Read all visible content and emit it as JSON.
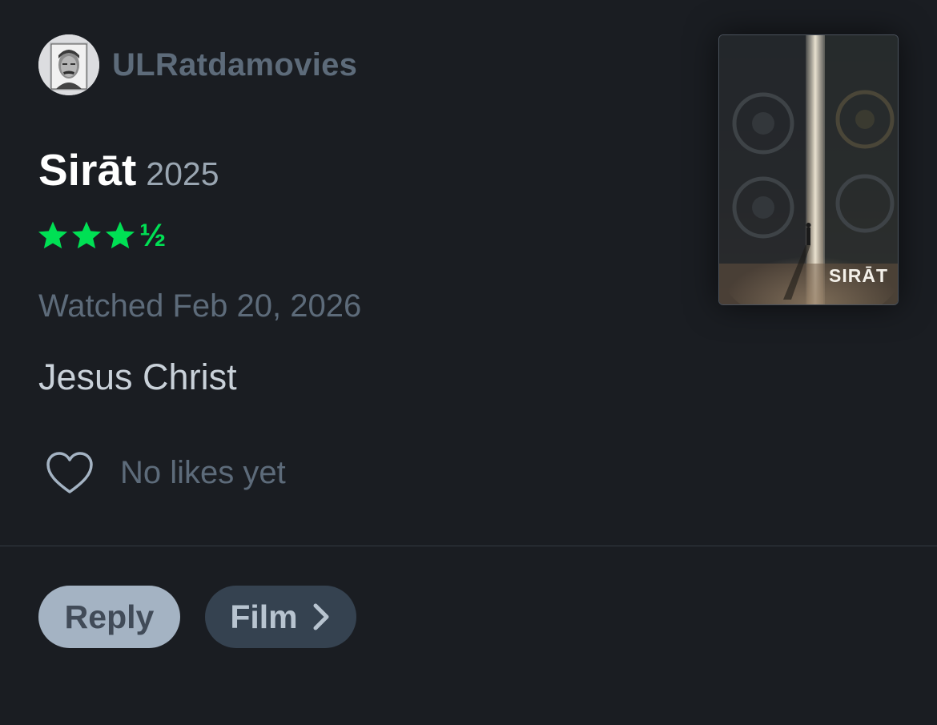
{
  "user": {
    "username": "ULRatdamovies",
    "avatar_icon": "user-avatar-photo"
  },
  "film": {
    "title": "Sirāt",
    "year": "2025",
    "poster_title": "SIRĀT"
  },
  "rating": {
    "stars": 3.5,
    "full_stars": 3,
    "half_label": "½",
    "color": "#00e054"
  },
  "watched": "Watched Feb 20, 2026",
  "review": "Jesus Christ",
  "likes": {
    "icon": "heart-icon",
    "text": "No likes yet"
  },
  "actions": {
    "reply_label": "Reply",
    "film_label": "Film",
    "film_icon": "chevron-right-icon"
  },
  "colors": {
    "background": "#1a1d22",
    "muted_text": "#5d6b7a",
    "reply_button": "#a4b3c3",
    "film_button": "#354250"
  }
}
